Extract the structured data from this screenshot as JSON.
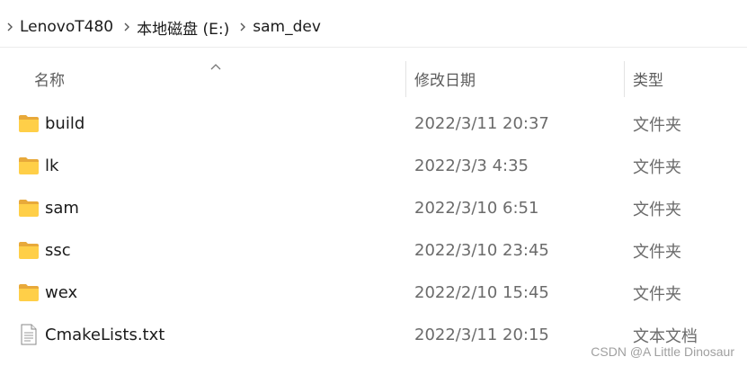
{
  "breadcrumb": {
    "items": [
      "LenovoT480",
      "本地磁盘 (E:)",
      "sam_dev"
    ]
  },
  "columns": {
    "name": "名称",
    "date": "修改日期",
    "type": "类型"
  },
  "sort": {
    "column": "name",
    "direction": "ascending"
  },
  "files": [
    {
      "name": "build",
      "date": "2022/3/11 20:37",
      "type": "文件夹",
      "icon": "folder-icon"
    },
    {
      "name": "lk",
      "date": "2022/3/3 4:35",
      "type": "文件夹",
      "icon": "folder-icon"
    },
    {
      "name": "sam",
      "date": "2022/3/10 6:51",
      "type": "文件夹",
      "icon": "folder-icon"
    },
    {
      "name": "ssc",
      "date": "2022/3/10 23:45",
      "type": "文件夹",
      "icon": "folder-icon"
    },
    {
      "name": "wex",
      "date": "2022/2/10 15:45",
      "type": "文件夹",
      "icon": "folder-icon"
    },
    {
      "name": "CmakeLists.txt",
      "date": "2022/3/11 20:15",
      "type": "文本文档",
      "icon": "text-file-icon"
    }
  ],
  "watermark": "CSDN @A Little Dinosaur",
  "colors": {
    "folder_back": "#E8A93A",
    "folder_front": "#FFCF48",
    "text_primary": "#1B1B1B",
    "text_secondary": "#6B6B6B"
  }
}
